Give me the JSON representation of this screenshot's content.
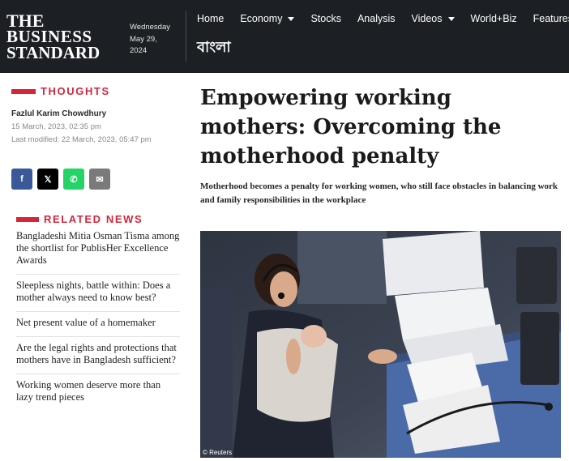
{
  "header": {
    "logo": {
      "line1": "THE",
      "line2": "BUSINESS",
      "line3": "STANDARD"
    },
    "date": {
      "weekday": "Wednesday",
      "day": "May 29,",
      "year": "2024"
    },
    "nav": [
      {
        "label": "Home",
        "dropdown": false
      },
      {
        "label": "Economy",
        "dropdown": true
      },
      {
        "label": "Stocks",
        "dropdown": false
      },
      {
        "label": "Analysis",
        "dropdown": false
      },
      {
        "label": "Videos",
        "dropdown": true
      },
      {
        "label": "World+Biz",
        "dropdown": false
      },
      {
        "label": "Features",
        "dropdown": true
      }
    ],
    "bangla_link": "বাংলা"
  },
  "sidebar": {
    "section_label": "THOUGHTS",
    "author": "Fazlul Karim Chowdhury",
    "published": "15 March, 2023, 02:35 pm",
    "modified": "Last modified: 22 March, 2023, 05:47 pm",
    "share": [
      {
        "name": "facebook",
        "glyph": "f",
        "color": "#3b5998"
      },
      {
        "name": "x",
        "glyph": "𝕏",
        "color": "#000000"
      },
      {
        "name": "whatsapp",
        "glyph": "✆",
        "color": "#25d366"
      },
      {
        "name": "email",
        "glyph": "✉",
        "color": "#7a7a7a"
      }
    ],
    "related_label": "RELATED NEWS",
    "related": [
      "Bangladeshi Mitia Osman Tisma among the shortlist for PublisHer Excellence Awards",
      "Sleepless nights, battle within: Does a mother always need to know best?",
      "Net present value of a homemaker",
      "Are the legal rights and protections that mothers have in Bangladesh sufficient?",
      "Working women deserve more than lazy trend pieces"
    ]
  },
  "article": {
    "headline": "Empowering working mothers: Overcoming the motherhood penalty",
    "summary": "Motherhood becomes a penalty for working women, who still face obstacles in balancing work and family responsibilities in the workplace",
    "photo_credit": "© Reuters"
  },
  "colors": {
    "accent": "#d6243a",
    "header_bg": "#1c1f23"
  }
}
